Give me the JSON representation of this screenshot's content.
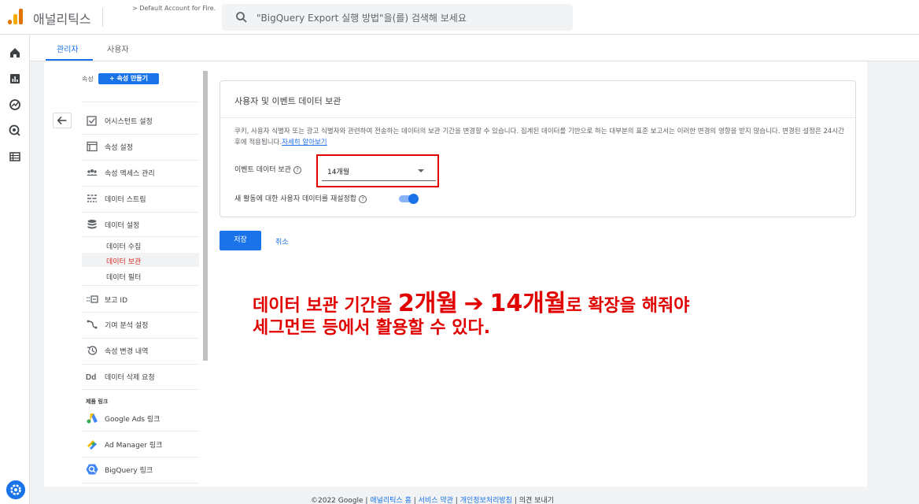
{
  "app": {
    "title": "애널리틱스",
    "account": "> Default Account for Fire..."
  },
  "search": {
    "placeholder": "\"BigQuery Export 실행 방법\"을(를) 검색해 보세요"
  },
  "tabs": [
    {
      "label": "관리자"
    },
    {
      "label": "사용자"
    }
  ],
  "property": {
    "label": "속성",
    "create_button": "+ 속성 만들기"
  },
  "nav": {
    "items": [
      {
        "label": "어시스턴트 설정",
        "icon": "checkbox-icon"
      },
      {
        "label": "속성 설정",
        "icon": "window-icon"
      },
      {
        "label": "속성 액세스 관리",
        "icon": "people-icon"
      },
      {
        "label": "데이터 스트림",
        "icon": "stream-icon"
      },
      {
        "label": "데이터 설정",
        "icon": "database-icon"
      }
    ],
    "sub_items": [
      {
        "label": "데이터 수집"
      },
      {
        "label": "데이터 보관"
      },
      {
        "label": "데이터 필터"
      }
    ],
    "items2": [
      {
        "label": "보고 ID",
        "icon": "report-id-icon"
      },
      {
        "label": "기여 분석 설정",
        "icon": "attribution-icon"
      },
      {
        "label": "속성 변경 내역",
        "icon": "history-icon"
      },
      {
        "label": "데이터 삭제 요청",
        "icon": "dd-icon"
      }
    ],
    "section_label": "제품 링크",
    "links": [
      {
        "label": "Google Ads 링크",
        "icon": "google-ads-icon"
      },
      {
        "label": "Ad Manager 링크",
        "icon": "ad-manager-icon"
      },
      {
        "label": "BigQuery 링크",
        "icon": "bigquery-icon"
      }
    ]
  },
  "card": {
    "title": "사용자 및 이벤트 데이터 보관",
    "description": "쿠키, 사용자 식별자 또는 광고 식별자와 관련하여 전송하는 데이터의 보관 기간을 변경할 수 있습니다. 집계된 데이터를 기반으로 하는 대부분의 표준 보고서는 이러한 변경의 영향을 받지 않습니다. 변경된 설정은 24시간 후에 적용됩니다.",
    "learn_more": "자세히 알아보기",
    "retention_label": "이벤트 데이터 보관",
    "retention_value": "14개월",
    "reset_label": "새 활동에 대한 사용자 데이터를 재설정합",
    "reset_enabled": true
  },
  "buttons": {
    "save": "저장",
    "cancel": "취소"
  },
  "annotation": {
    "line1_a": "데이터 보관 기간을 ",
    "line1_b": "2개월",
    "line1_arrow": "➔",
    "line1_c": "14개월",
    "line1_d": "로 확장을 해줘야",
    "line2": "세그먼트 등에서 활용할 수 있다."
  },
  "footer": {
    "copyright": "©2022 Google",
    "link1": "애널리틱스 홈",
    "link2": "서비스 약관",
    "link3": "개인정보처리방침",
    "link4": "의견 보내기",
    "separator": "|"
  },
  "colors": {
    "accent": "#1a73e8",
    "annotation": "#e00000",
    "logo_orange": "#e37400",
    "logo_yellow": "#f9ab00"
  }
}
